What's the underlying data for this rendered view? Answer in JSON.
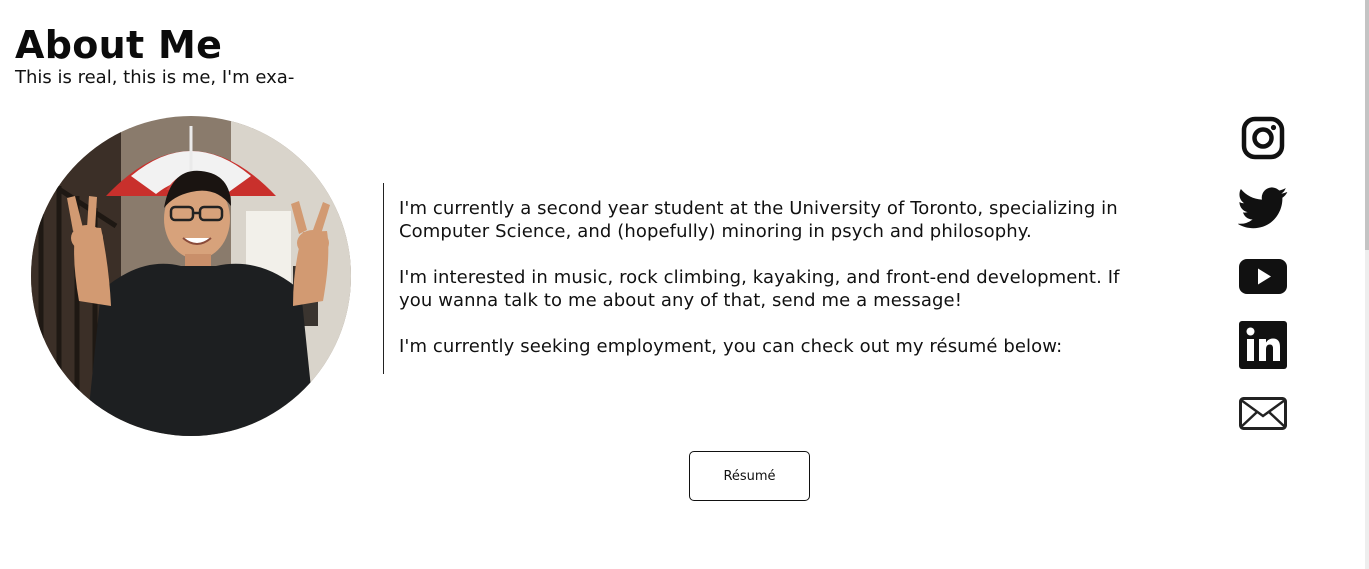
{
  "header": {
    "title": "About Me",
    "subtitle": "This is real, this is me, I'm exa-"
  },
  "bio": {
    "paragraphs": [
      "I'm currently a second year student at the University of Toronto, specializing in Computer Science, and (hopefully) minoring in psych and philosophy.",
      "I'm interested in music, rock climbing, kayaking, and front-end development. If you wanna talk to me about any of that, send me a message!",
      "I'm currently seeking employment, you can check out my résumé below:"
    ]
  },
  "resume_button": {
    "label": "Résumé"
  },
  "social_links": [
    {
      "icon": "instagram-icon"
    },
    {
      "icon": "twitter-icon"
    },
    {
      "icon": "youtube-icon"
    },
    {
      "icon": "linkedin-icon"
    },
    {
      "icon": "mail-icon"
    }
  ],
  "colors": {
    "text": "#111111",
    "background": "#ffffff",
    "divider": "#222222"
  }
}
